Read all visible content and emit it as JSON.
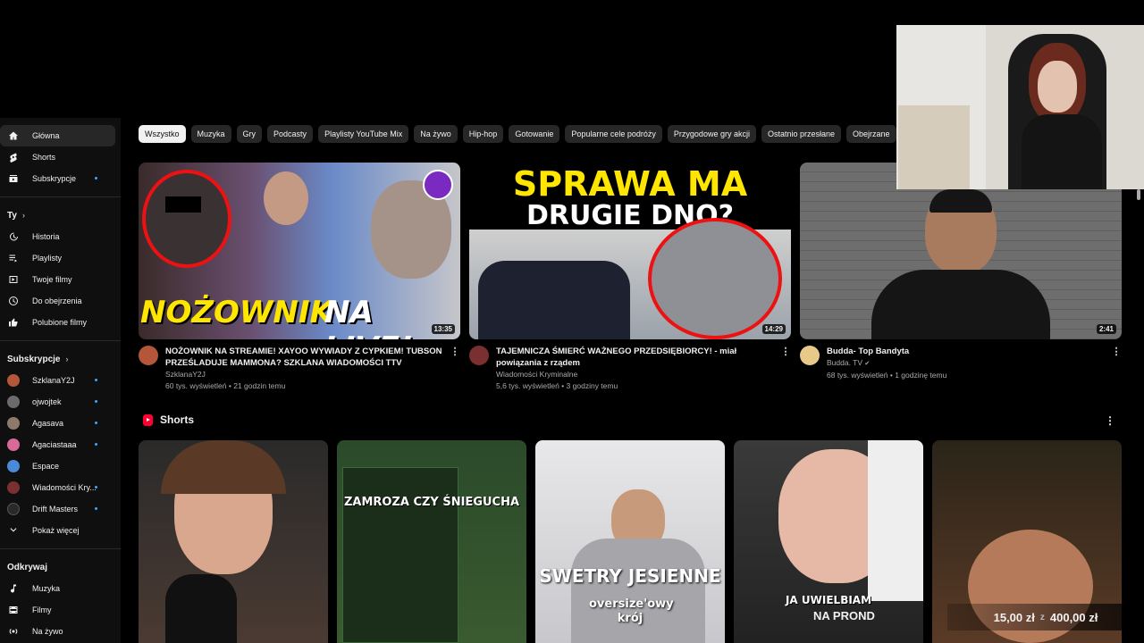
{
  "sidebar": {
    "main": [
      {
        "label": "Główna",
        "icon": "home-icon",
        "active": true
      },
      {
        "label": "Shorts",
        "icon": "shorts-icon"
      },
      {
        "label": "Subskrypcje",
        "icon": "subscriptions-icon",
        "dot": true
      }
    ],
    "you_title": "Ty",
    "you": [
      {
        "label": "Historia",
        "icon": "history-icon"
      },
      {
        "label": "Playlisty",
        "icon": "playlists-icon"
      },
      {
        "label": "Twoje filmy",
        "icon": "your-videos-icon"
      },
      {
        "label": "Do obejrzenia",
        "icon": "watch-later-icon"
      },
      {
        "label": "Polubione filmy",
        "icon": "liked-icon"
      }
    ],
    "subs_title": "Subskrypcje",
    "subs": [
      {
        "label": "SzklanaY2J",
        "color": "#b4563a"
      },
      {
        "label": "ojwojtek",
        "color": "#6b6b6b"
      },
      {
        "label": "Agasava",
        "color": "#8e7a6a"
      },
      {
        "label": "Agaciastaaa",
        "color": "#d86a9a"
      },
      {
        "label": "Espace",
        "color": "#4a8ad8"
      },
      {
        "label": "Wiadomości Kry...",
        "color": "#7a3030"
      },
      {
        "label": "Drift Masters",
        "color": "#2a2a2a"
      }
    ],
    "show_more": "Pokaż więcej",
    "explore_title": "Odkrywaj",
    "explore": [
      {
        "label": "Muzyka",
        "icon": "music-icon"
      },
      {
        "label": "Filmy",
        "icon": "movies-icon"
      },
      {
        "label": "Na żywo",
        "icon": "live-icon"
      }
    ]
  },
  "chips": [
    "Wszystko",
    "Muzyka",
    "Gry",
    "Podcasty",
    "Playlisty YouTube Mix",
    "Na żywo",
    "Hip-hop",
    "Gotowanie",
    "Popularne cele podróży",
    "Przygodowe gry akcji",
    "Ostatnio przesłane",
    "Obejrzane"
  ],
  "videos": [
    {
      "title": "NOŻOWNIK NA STREAMIE! XAYOO WYWIADY Z CYPKIEM! TUBSON PRZEŚLADUJE MAMMONA? SZKLANA WIADOMOŚCI TTV",
      "channel": "SzklanaY2J",
      "stats": "60 tys. wyświetleń • 21 godzin temu",
      "duration": "13:35",
      "thumb_text_1": "NOŻOWNIK",
      "thumb_text_2": "NA LIVE!"
    },
    {
      "title": "TAJEMNICZA ŚMIERĆ WAŻNEGO PRZEDSIĘBIORCY! - miał powiązania z rządem",
      "channel": "Wiadomości Kryminalne",
      "stats": "5,6 tys. wyświetleń • 3 godziny temu",
      "duration": "14:29",
      "thumb_text_1": "SPRAWA MA",
      "thumb_text_2": "DRUGIE DNO?"
    },
    {
      "title": "Budda- Top Bandyta",
      "channel": "Budda. TV",
      "stats": "68 tys. wyświetleń • 1 godzinę temu",
      "duration": "2:41"
    }
  ],
  "shorts": {
    "title": "Shorts",
    "items": [
      {
        "caption": ""
      },
      {
        "caption": "ZAMROZA CZY ŚNIEGUCHA"
      },
      {
        "caption": "SWETRY JESIENNE",
        "caption2": "oversize'owy krój"
      },
      {
        "caption": "JA UWIELBIAM"
      },
      {
        "caption": ""
      }
    ]
  },
  "overlay": {
    "label": "NA PROND",
    "amount_from": "15,00 zł",
    "sep": "z",
    "amount_to": "400,00 zł"
  }
}
